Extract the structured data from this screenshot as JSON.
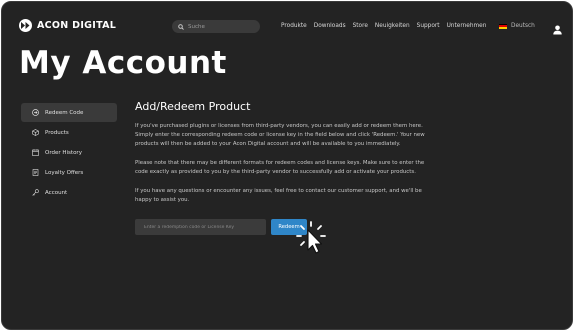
{
  "header": {
    "logo_text": "ACON DIGITAL",
    "search_placeholder": "Suche",
    "nav": [
      "Produkte",
      "Downloads",
      "Store",
      "Neuigkeiten",
      "Support",
      "Unternehmen"
    ],
    "language": "Deutsch"
  },
  "page_title": "My Account",
  "sidebar": {
    "items": [
      {
        "label": "Redeem Code",
        "icon": "redeem-icon",
        "active": true
      },
      {
        "label": "Products",
        "icon": "cube-icon",
        "active": false
      },
      {
        "label": "Order History",
        "icon": "calendar-icon",
        "active": false
      },
      {
        "label": "Loyalty Offers",
        "icon": "document-icon",
        "active": false
      },
      {
        "label": "Account",
        "icon": "key-icon",
        "active": false
      }
    ]
  },
  "main": {
    "title": "Add/Redeem Product",
    "paragraphs": [
      "If you've purchased plugins or licenses from third-party vendors, you can easily add or redeem them here. Simply enter the corresponding redeem code or license key in the field below and click 'Redeem.' Your new products will then be added to your Acon Digital account and will be available to you immediately.",
      "Please note that there may be different formats for redeem codes and license keys. Make sure to enter the code exactly as provided to you by the third-party vendor to successfully add or activate your products.",
      "If you have any questions or encounter any issues, feel free to contact our customer support, and we'll be happy to assist you."
    ],
    "input_placeholder": "Enter a redemption code or License Key",
    "button_label": "Redeem"
  },
  "colors": {
    "background": "#232323",
    "accent": "#2f86c8",
    "sidebar_active": "#3a3a3a"
  }
}
